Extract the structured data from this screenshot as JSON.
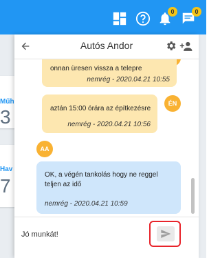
{
  "topbar": {
    "notifications_count": "0",
    "messages_count": "0",
    "icons": [
      "dashboard-icon",
      "help-icon",
      "bell-icon",
      "chat-icon"
    ]
  },
  "background": {
    "card1_label": "Műh",
    "card1_value": "3",
    "card2_label": "Hav",
    "card2_value": "7"
  },
  "chat": {
    "title": "Autós Andor",
    "messages": [
      {
        "text": "onnan üresen vissza a telepre",
        "meta": "nemrég - 2020.04.21 10:55"
      },
      {
        "text": "aztán 15:00 órára az építkezésre",
        "meta": "nemrég - 2020.04.21 10:56",
        "avatar": "ÉN"
      },
      {
        "text_line1": "OK, a végén tankolás hogy ne reggel",
        "text_line2": "teljen az idő",
        "meta": "nemrég - 2020.04.21 10:59",
        "avatar": "AA"
      }
    ],
    "input_value": "Jó munkát!"
  },
  "colors": {
    "topbar": "#2196f3",
    "own_bubble": "#fde7b0",
    "other_bubble": "#cfe6fb",
    "avatar": "#f9b233",
    "highlight": "#e8232a"
  }
}
